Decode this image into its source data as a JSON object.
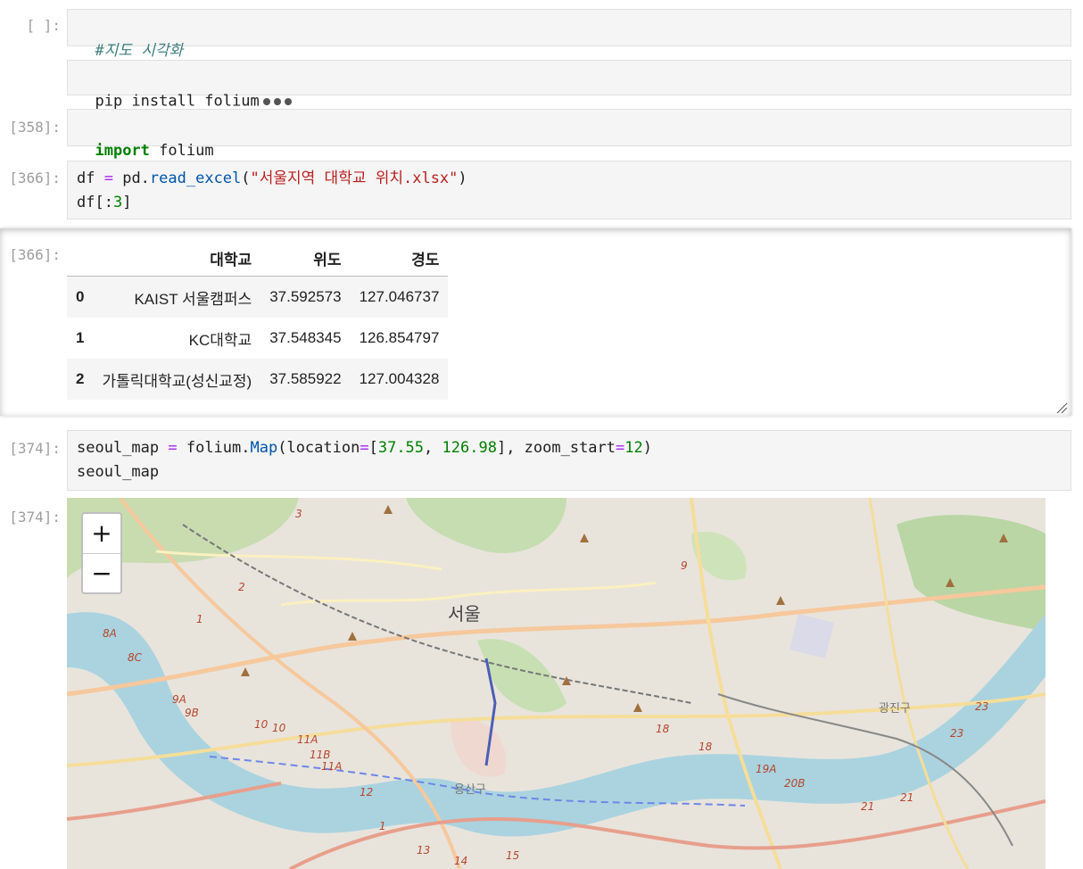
{
  "cells": [
    {
      "prompt": "[ ]:",
      "comment": "#지도 시각화"
    },
    {
      "code": "pip install folium"
    },
    {
      "prompt": "[358]:",
      "keyword": "import",
      "module": " folium"
    },
    {
      "prompt": "[366]:",
      "df_var": "df",
      "eq": " = ",
      "pd": "pd.",
      "fn": "read_excel",
      "open": "(",
      "filename": "\"서울지역 대학교 위치.xlsx\"",
      "close": ")",
      "line2_a": "df",
      "line2_b": "[:",
      "line2_num": "3",
      "line2_c": "]"
    },
    {
      "prompt": "[374]:",
      "var": "seoul_map",
      "eq": " = ",
      "obj": "folium.",
      "fn": "Map",
      "p1": "(location",
      "eq2": "=",
      "br1": "[",
      "lat": "37.55",
      "comma": ", ",
      "lon": "126.98",
      "br2": "]",
      "p2": ", zoom_start",
      "eq3": "=",
      "zoom": "12",
      "p3": ")",
      "line2": "seoul_map"
    }
  ],
  "output_366": {
    "prompt": "[366]:",
    "columns": [
      "대학교",
      "위도",
      "경도"
    ],
    "rows": [
      {
        "index": "0",
        "name": "KAIST 서울캠퍼스",
        "lat": "37.592573",
        "lon": "127.046737"
      },
      {
        "index": "1",
        "name": "KC대학교",
        "lat": "37.548345",
        "lon": "126.854797"
      },
      {
        "index": "2",
        "name": "가톨릭대학교(성신교정)",
        "lat": "37.585922",
        "lon": "127.004328"
      }
    ]
  },
  "output_374": {
    "prompt": "[374]:",
    "zoom_in": "+",
    "zoom_out": "−",
    "labels": {
      "city": "서울",
      "district1": "용산구",
      "district2": "광진구"
    },
    "route_numbers": [
      "3",
      "2",
      "1",
      "8A",
      "8C",
      "9A",
      "9B",
      "10",
      "10",
      "11A",
      "11B",
      "11A",
      "12",
      "13",
      "14",
      "15",
      "9",
      "18",
      "18",
      "19A",
      "20B",
      "21",
      "21",
      "23",
      "23",
      "1"
    ]
  },
  "colors": {
    "cell_bg": "#f5f5f5",
    "keyword": "#008000",
    "string": "#ba2121",
    "function": "#0055aa",
    "operator": "#aa22ff",
    "river": "#aad3df",
    "park": "#c8e0b4"
  }
}
